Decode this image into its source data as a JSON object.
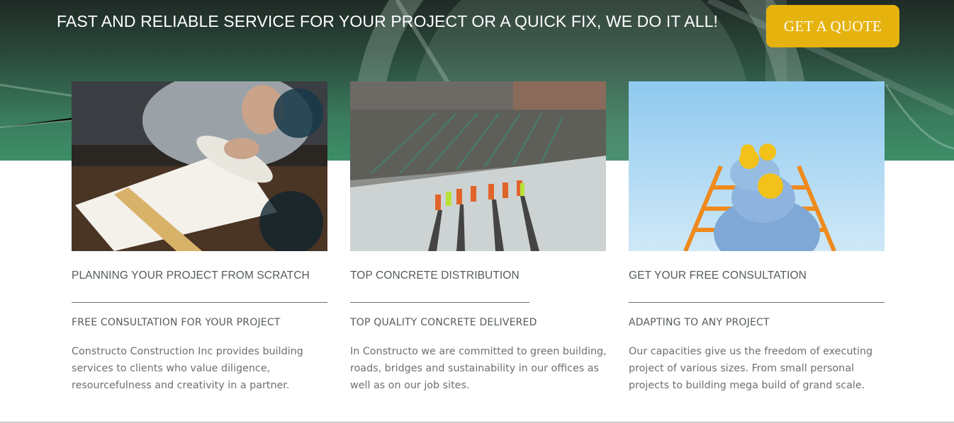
{
  "hero": {
    "tagline": "FAST AND RELIABLE SERVICE FOR YOUR PROJECT OR A QUICK FIX, WE DO IT ALL!",
    "quote_button": "GET A QUOTE",
    "accent_color": "#e6b20e"
  },
  "cards": [
    {
      "title": "PLANNING YOUR PROJECT FROM SCRATCH",
      "subtitle": "FREE CONSULTATION FOR YOUR PROJECT",
      "description": "Constructo Construction Inc provides building services to clients who value diligence, resourcefulness and creativity in a partner."
    },
    {
      "title": "TOP CONCRETE DISTRIBUTION",
      "subtitle": "TOP QUALITY CONCRETE DELIVERED",
      "description": "In Constructo we are committed to green building, roads, bridges and sustainability in our offices as well as on our job sites."
    },
    {
      "title": "GET YOUR FREE CONSULTATION",
      "subtitle": "ADAPTING TO ANY PROJECT",
      "description": "Our capacities give us the freedom of executing project of various sizes. From small personal projects to building mega build of grand scale."
    }
  ]
}
